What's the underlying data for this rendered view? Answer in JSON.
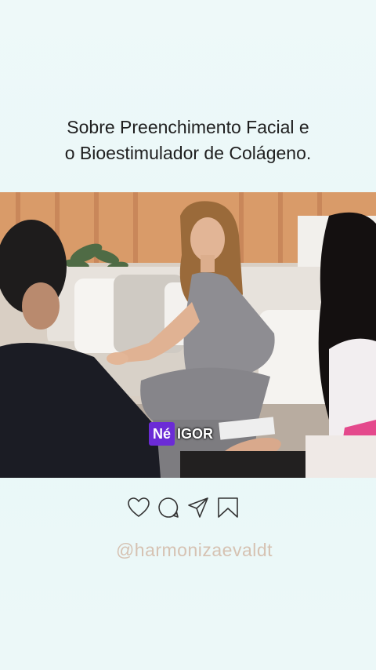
{
  "post": {
    "title_line1": "Sobre Preenchimento Facial e",
    "title_line2": "o Bioestimulador de Colágeno."
  },
  "video": {
    "caption_highlight": "Né",
    "caption_rest": "IGOR"
  },
  "actions": {
    "icons": [
      "heart-icon",
      "comment-icon",
      "share-icon",
      "bookmark-icon"
    ]
  },
  "account": {
    "handle": "@harmonizaevaldt"
  },
  "colors": {
    "background": "#ebf8f8",
    "caption_highlight": "#6b2bd6",
    "handle": "#d6c2b2",
    "icon_stroke": "#333333"
  }
}
